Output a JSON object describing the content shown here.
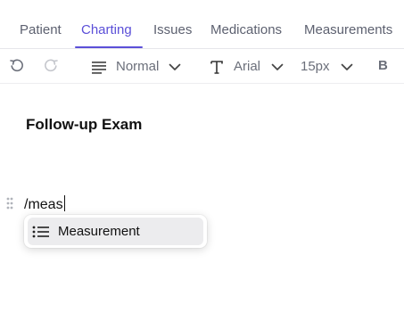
{
  "tabs": [
    {
      "label": "Patient"
    },
    {
      "label": "Charting"
    },
    {
      "label": "Issues"
    },
    {
      "label": "Medications"
    },
    {
      "label": "Measurements"
    }
  ],
  "active_tab": "Charting",
  "toolbar": {
    "block_type": "Normal",
    "font_family": "Arial",
    "font_size": "15px",
    "bold_label": "B"
  },
  "editor": {
    "heading": "Follow-up Exam",
    "current_line": "/meas"
  },
  "slash_menu": {
    "items": [
      {
        "label": "Measurement",
        "icon": "list-icon"
      }
    ]
  },
  "colors": {
    "accent": "#5b4fd8",
    "menu_highlight": "#ececee"
  }
}
